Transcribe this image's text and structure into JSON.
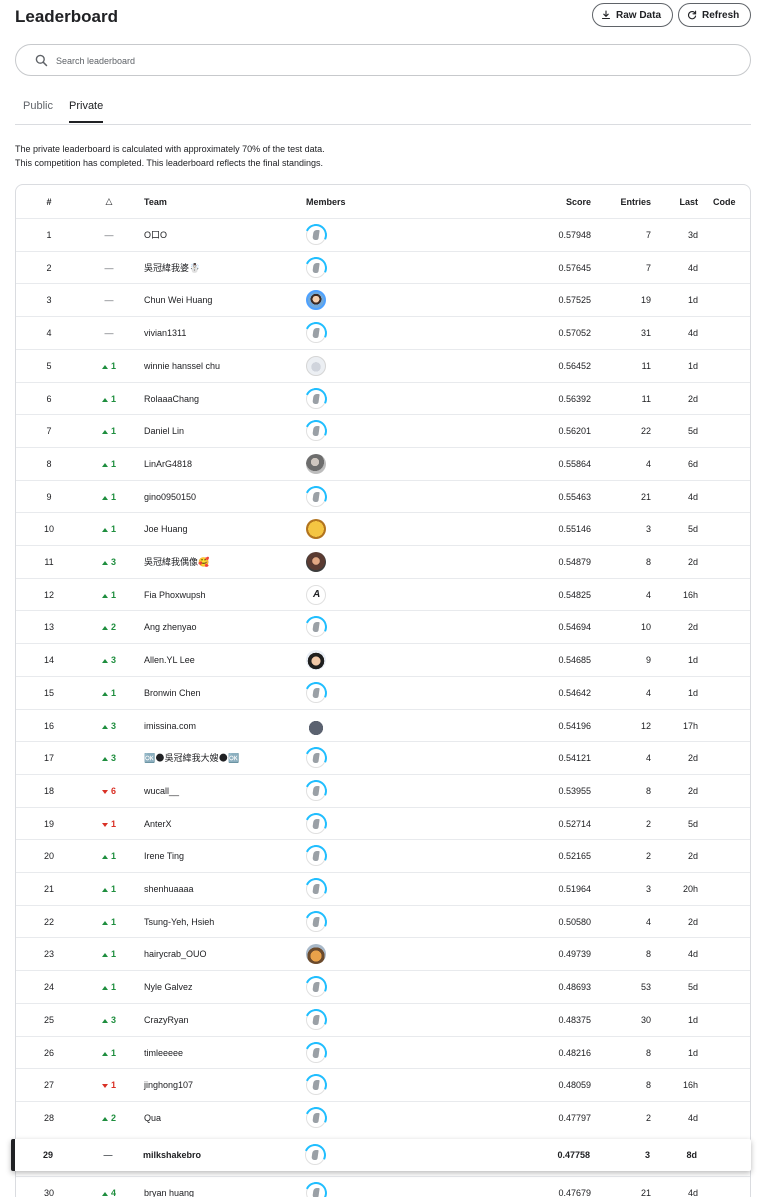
{
  "header": {
    "title": "Leaderboard",
    "raw_data_label": "Raw Data",
    "refresh_label": "Refresh"
  },
  "search": {
    "placeholder": "Search leaderboard",
    "value": ""
  },
  "tabs": [
    {
      "label": "Public",
      "active": false
    },
    {
      "label": "Private",
      "active": true
    }
  ],
  "info": {
    "line1": "The private leaderboard is calculated with approximately 70% of the test data.",
    "line2": "This competition has completed. This leaderboard reflects the final standings."
  },
  "table": {
    "columns": {
      "rank": "#",
      "delta": "△",
      "team": "Team",
      "members": "Members",
      "score": "Score",
      "entries": "Entries",
      "last": "Last",
      "code": "Code"
    },
    "rows": [
      {
        "rank": "1",
        "delta": "—",
        "dir": "same",
        "team": "O口O",
        "avatar": "generic",
        "score": "0.57948",
        "entries": "7",
        "last": "3d"
      },
      {
        "rank": "2",
        "delta": "—",
        "dir": "same",
        "team": "吳冠緯我婆☃️",
        "avatar": "generic",
        "score": "0.57645",
        "entries": "7",
        "last": "4d"
      },
      {
        "rank": "3",
        "delta": "—",
        "dir": "same",
        "team": "Chun Wei Huang",
        "avatar": "photo-blue",
        "score": "0.57525",
        "entries": "19",
        "last": "1d"
      },
      {
        "rank": "4",
        "delta": "—",
        "dir": "same",
        "team": "vivian1311",
        "avatar": "generic",
        "score": "0.57052",
        "entries": "31",
        "last": "4d"
      },
      {
        "rank": "5",
        "delta": "1",
        "dir": "up",
        "team": "winnie hanssel chu",
        "avatar": "photo-light",
        "score": "0.56452",
        "entries": "11",
        "last": "1d"
      },
      {
        "rank": "6",
        "delta": "1",
        "dir": "up",
        "team": "RolaaaChang",
        "avatar": "generic",
        "score": "0.56392",
        "entries": "11",
        "last": "2d"
      },
      {
        "rank": "7",
        "delta": "1",
        "dir": "up",
        "team": "Daniel Lin",
        "avatar": "generic",
        "score": "0.56201",
        "entries": "22",
        "last": "5d"
      },
      {
        "rank": "8",
        "delta": "1",
        "dir": "up",
        "team": "LinArG4818",
        "avatar": "photo-gray",
        "score": "0.55864",
        "entries": "4",
        "last": "6d"
      },
      {
        "rank": "9",
        "delta": "1",
        "dir": "up",
        "team": "gino0950150",
        "avatar": "generic",
        "score": "0.55463",
        "entries": "21",
        "last": "4d"
      },
      {
        "rank": "10",
        "delta": "1",
        "dir": "up",
        "team": "Joe Huang",
        "avatar": "photo-yellow",
        "score": "0.55146",
        "entries": "3",
        "last": "5d"
      },
      {
        "rank": "11",
        "delta": "3",
        "dir": "up",
        "team": "吳冠緯我偶像🥰",
        "avatar": "photo-dark",
        "score": "0.54879",
        "entries": "8",
        "last": "2d"
      },
      {
        "rank": "12",
        "delta": "1",
        "dir": "up",
        "team": "Fia Phoxwupsh",
        "avatar": "photo-line",
        "score": "0.54825",
        "entries": "4",
        "last": "16h"
      },
      {
        "rank": "13",
        "delta": "2",
        "dir": "up",
        "team": "Ang zhenyao",
        "avatar": "generic",
        "score": "0.54694",
        "entries": "10",
        "last": "2d"
      },
      {
        "rank": "14",
        "delta": "3",
        "dir": "up",
        "team": "Allen.YL Lee",
        "avatar": "photo-face",
        "score": "0.54685",
        "entries": "9",
        "last": "1d"
      },
      {
        "rank": "15",
        "delta": "1",
        "dir": "up",
        "team": "Bronwin Chen",
        "avatar": "generic",
        "score": "0.54642",
        "entries": "4",
        "last": "1d"
      },
      {
        "rank": "16",
        "delta": "3",
        "dir": "up",
        "team": "imissina.com",
        "avatar": "photo-cat",
        "score": "0.54196",
        "entries": "12",
        "last": "17h"
      },
      {
        "rank": "17",
        "delta": "3",
        "dir": "up",
        "team": "🆗🌑吳冠緯我大嫂🌑🆗",
        "avatar": "generic",
        "score": "0.54121",
        "entries": "4",
        "last": "2d"
      },
      {
        "rank": "18",
        "delta": "6",
        "dir": "down",
        "team": "wucall__",
        "avatar": "generic",
        "score": "0.53955",
        "entries": "8",
        "last": "2d"
      },
      {
        "rank": "19",
        "delta": "1",
        "dir": "down",
        "team": "AnterX",
        "avatar": "generic",
        "score": "0.52714",
        "entries": "2",
        "last": "5d"
      },
      {
        "rank": "20",
        "delta": "1",
        "dir": "up",
        "team": "Irene Ting",
        "avatar": "generic",
        "score": "0.52165",
        "entries": "2",
        "last": "2d"
      },
      {
        "rank": "21",
        "delta": "1",
        "dir": "up",
        "team": "shenhuaaaa",
        "avatar": "generic",
        "score": "0.51964",
        "entries": "3",
        "last": "20h"
      },
      {
        "rank": "22",
        "delta": "1",
        "dir": "up",
        "team": "Tsung-Yeh, Hsieh",
        "avatar": "generic",
        "score": "0.50580",
        "entries": "4",
        "last": "2d"
      },
      {
        "rank": "23",
        "delta": "1",
        "dir": "up",
        "team": "hairycrab_OUO",
        "avatar": "photo-sunset",
        "score": "0.49739",
        "entries": "8",
        "last": "4d"
      },
      {
        "rank": "24",
        "delta": "1",
        "dir": "up",
        "team": "Nyle Galvez",
        "avatar": "generic",
        "score": "0.48693",
        "entries": "53",
        "last": "5d"
      },
      {
        "rank": "25",
        "delta": "3",
        "dir": "up",
        "team": "CrazyRyan",
        "avatar": "generic",
        "score": "0.48375",
        "entries": "30",
        "last": "1d"
      },
      {
        "rank": "26",
        "delta": "1",
        "dir": "up",
        "team": "timleeeee",
        "avatar": "generic",
        "score": "0.48216",
        "entries": "8",
        "last": "1d"
      },
      {
        "rank": "27",
        "delta": "1",
        "dir": "down",
        "team": "jinghong107",
        "avatar": "generic",
        "score": "0.48059",
        "entries": "8",
        "last": "16h"
      },
      {
        "rank": "28",
        "delta": "2",
        "dir": "up",
        "team": "Qua",
        "avatar": "generic",
        "score": "0.47797",
        "entries": "2",
        "last": "4d"
      }
    ],
    "current_user_row": {
      "rank": "29",
      "delta": "—",
      "dir": "same",
      "team": "milkshakebro",
      "avatar": "generic",
      "score": "0.47758",
      "entries": "3",
      "last": "8d"
    },
    "partial_row": {
      "rank": "30",
      "delta": "4",
      "dir": "up",
      "team": "bryan huang",
      "avatar": "generic",
      "score": "0.47679",
      "entries": "21",
      "last": "4d"
    }
  },
  "icons": {
    "download": "download-icon",
    "refresh": "refresh-icon",
    "search": "search-icon"
  }
}
